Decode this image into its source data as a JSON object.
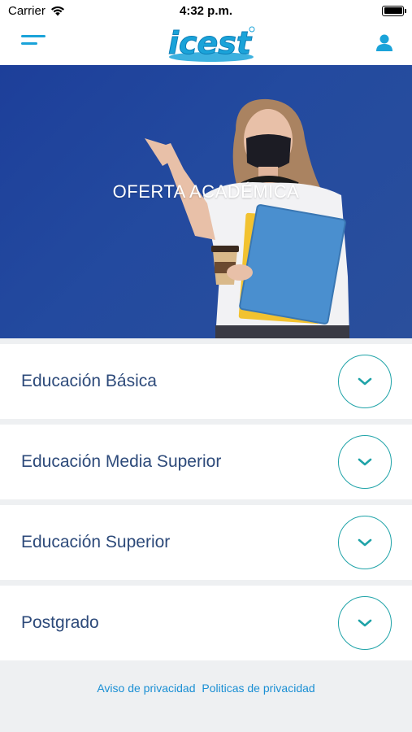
{
  "status_bar": {
    "carrier": "Carrier",
    "time": "4:32 p.m."
  },
  "nav": {
    "logo_text": "icest",
    "icons": {
      "menu": "hamburger-menu-icon",
      "user": "user-icon",
      "wifi": "wifi-icon",
      "battery": "battery-icon"
    }
  },
  "hero": {
    "title": "OFERTA ACADÉMICA"
  },
  "accordion": [
    {
      "label": "Educación Básica"
    },
    {
      "label": "Educación Media Superior"
    },
    {
      "label": "Educación Superior"
    },
    {
      "label": "Postgrado"
    }
  ],
  "footer": {
    "privacy_notice": "Aviso de privacidad",
    "privacy_policies": "Politicas de privacidad"
  },
  "colors": {
    "accent": "#1aa3d9",
    "teal": "#1fa3a8",
    "hero_bg": "#234a9f",
    "label": "#2d4a7a",
    "link": "#1a8fd4"
  }
}
